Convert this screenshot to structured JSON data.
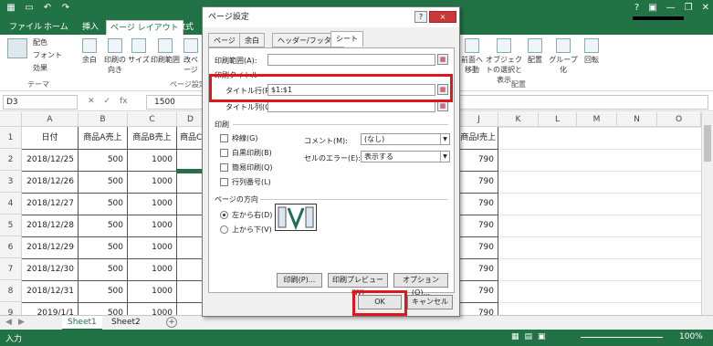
{
  "ribbon": {
    "tabs": [
      "ファイル",
      "ホーム",
      "挿入",
      "ページ レイアウト",
      "数式"
    ],
    "theme_items": [
      "配色",
      "フォント",
      "効果"
    ],
    "theme_group": "テーマ",
    "pagesetup_items": [
      "余白",
      "印刷の向き",
      "サイズ",
      "印刷範囲",
      "改ページ"
    ],
    "pagesetup_group": "ページ設定",
    "arrange_items": [
      "前面へ移動",
      "オブジェクトの選択と表示",
      "配置",
      "グループ化",
      "回転"
    ],
    "arrange_group": "配置"
  },
  "formula": {
    "name_box": "D3",
    "value": "1500",
    "fx": "fx"
  },
  "grid": {
    "columns": [
      "A",
      "B",
      "C",
      "D",
      "J",
      "K",
      "L",
      "M",
      "N",
      "O"
    ],
    "header_row": [
      "日付",
      "商品A売上",
      "商品B売上",
      "商品C"
    ],
    "header_right": "商品I売上",
    "rows": [
      {
        "num": "2",
        "date": "2018/12/25",
        "a": "500",
        "b": "1000",
        "right": "790"
      },
      {
        "num": "3",
        "date": "2018/12/26",
        "a": "500",
        "b": "1000",
        "right": "790"
      },
      {
        "num": "4",
        "date": "2018/12/27",
        "a": "500",
        "b": "1000",
        "right": "790"
      },
      {
        "num": "5",
        "date": "2018/12/28",
        "a": "500",
        "b": "1000",
        "right": "790"
      },
      {
        "num": "6",
        "date": "2018/12/29",
        "a": "500",
        "b": "1000",
        "right": "790"
      },
      {
        "num": "7",
        "date": "2018/12/30",
        "a": "500",
        "b": "1000",
        "right": "790"
      },
      {
        "num": "8",
        "date": "2018/12/31",
        "a": "500",
        "b": "1000",
        "right": "790"
      },
      {
        "num": "9",
        "date": "2019/1/1",
        "a": "500",
        "b": "1000",
        "right": "790"
      }
    ],
    "row1_num": "1"
  },
  "sheets": {
    "tabs": [
      "Sheet1",
      "Sheet2"
    ],
    "add": "+"
  },
  "status": {
    "left": "入力",
    "zoom": "100%"
  },
  "dialog": {
    "title": "ページ設定",
    "help": "?",
    "close": "×",
    "tabs": [
      "ページ",
      "余白",
      "ヘッダー/フッター",
      "シート"
    ],
    "print_area_label": "印刷範囲(A):",
    "print_titles_label": "印刷タイトル",
    "title_rows_label": "タイトル行(R):",
    "title_rows_value": "$1:$1",
    "title_cols_label": "タイトル列(C):",
    "print_section": "印刷",
    "checks": [
      "枠線(G)",
      "白黒印刷(B)",
      "簡易印刷(Q)",
      "行列番号(L)"
    ],
    "comment_label": "コメント(M):",
    "comment_value": "(なし)",
    "error_label": "セルのエラー(E):",
    "error_value": "表示する",
    "order_section": "ページの方向",
    "order_opts": [
      "左から右(D)",
      "上から下(V)"
    ],
    "buttons": [
      "印刷(P)...",
      "印刷プレビュー(W)",
      "オプション(O)..."
    ],
    "ok": "OK",
    "cancel": "キャンセル"
  },
  "colors": {
    "excel_green": "#217346",
    "highlight": "#e0161a"
  }
}
